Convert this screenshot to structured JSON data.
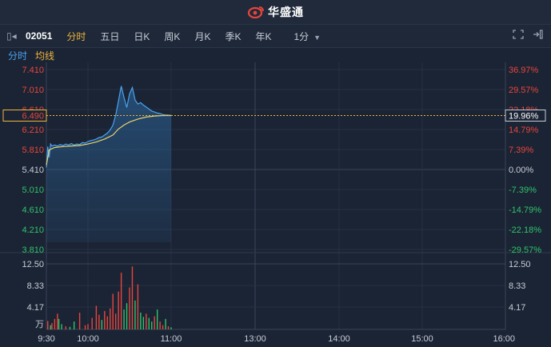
{
  "header": {
    "brand": "华盛通"
  },
  "toolbar": {
    "code": "02051",
    "tabs": [
      "分时",
      "五日",
      "日K",
      "周K",
      "月K",
      "季K",
      "年K"
    ],
    "active_tab": 0,
    "period": "1分"
  },
  "subbar": {
    "line1": "分时",
    "line2": "均线"
  },
  "colors": {
    "background": "#1b2434",
    "up": "#e8453c",
    "down": "#2fc36c",
    "neutral": "#c7cdd8",
    "price_line": "#4aa3f0",
    "avg_line": "#e8d46a",
    "accent": "#f0b43c"
  },
  "chart_data": {
    "type": "line",
    "price_axis": {
      "left_labels": [
        "7.410",
        "7.010",
        "6.610",
        "6.210",
        "5.810",
        "5.410",
        "5.010",
        "4.610",
        "4.210",
        "3.810"
      ],
      "right_labels": [
        "36.97%",
        "29.57%",
        "22.18%",
        "14.79%",
        "7.39%",
        "0.00%",
        "-7.39%",
        "-14.79%",
        "-22.18%",
        "-29.57%"
      ],
      "ylim": [
        3.61,
        7.61
      ],
      "prev_close": 5.41
    },
    "current": {
      "price": "6.490",
      "change_pct": "19.96%"
    },
    "x_labels": [
      "9:30",
      "10:00",
      "11:00",
      "13:00",
      "14:00",
      "15:00",
      "16:00"
    ],
    "price_series": [
      {
        "t": 0,
        "v": 5.45
      },
      {
        "t": 1,
        "v": 5.87
      },
      {
        "t": 2,
        "v": 5.65
      },
      {
        "t": 3,
        "v": 5.92
      },
      {
        "t": 4,
        "v": 5.88
      },
      {
        "t": 6,
        "v": 5.9
      },
      {
        "t": 8,
        "v": 5.88
      },
      {
        "t": 10,
        "v": 5.91
      },
      {
        "t": 12,
        "v": 5.89
      },
      {
        "t": 14,
        "v": 5.92
      },
      {
        "t": 16,
        "v": 5.9
      },
      {
        "t": 18,
        "v": 5.93
      },
      {
        "t": 20,
        "v": 5.9
      },
      {
        "t": 22,
        "v": 5.92
      },
      {
        "t": 24,
        "v": 5.91
      },
      {
        "t": 26,
        "v": 5.95
      },
      {
        "t": 28,
        "v": 5.94
      },
      {
        "t": 30,
        "v": 5.97
      },
      {
        "t": 32,
        "v": 5.99
      },
      {
        "t": 34,
        "v": 6.0
      },
      {
        "t": 36,
        "v": 6.02
      },
      {
        "t": 38,
        "v": 6.05
      },
      {
        "t": 40,
        "v": 6.06
      },
      {
        "t": 42,
        "v": 6.1
      },
      {
        "t": 44,
        "v": 6.14
      },
      {
        "t": 46,
        "v": 6.2
      },
      {
        "t": 48,
        "v": 6.3
      },
      {
        "t": 50,
        "v": 6.5
      },
      {
        "t": 52,
        "v": 6.78
      },
      {
        "t": 54,
        "v": 7.08
      },
      {
        "t": 56,
        "v": 6.85
      },
      {
        "t": 58,
        "v": 6.65
      },
      {
        "t": 60,
        "v": 6.92
      },
      {
        "t": 62,
        "v": 7.05
      },
      {
        "t": 64,
        "v": 6.8
      },
      {
        "t": 66,
        "v": 6.72
      },
      {
        "t": 68,
        "v": 6.75
      },
      {
        "t": 70,
        "v": 6.7
      },
      {
        "t": 72,
        "v": 6.66
      },
      {
        "t": 74,
        "v": 6.62
      },
      {
        "t": 76,
        "v": 6.58
      },
      {
        "t": 78,
        "v": 6.56
      },
      {
        "t": 80,
        "v": 6.54
      },
      {
        "t": 82,
        "v": 6.53
      },
      {
        "t": 84,
        "v": 6.51
      },
      {
        "t": 86,
        "v": 6.5
      },
      {
        "t": 88,
        "v": 6.5
      },
      {
        "t": 90,
        "v": 6.49
      }
    ],
    "avg_series": [
      {
        "t": 0,
        "v": 5.5
      },
      {
        "t": 2,
        "v": 5.8
      },
      {
        "t": 6,
        "v": 5.85
      },
      {
        "t": 12,
        "v": 5.87
      },
      {
        "t": 18,
        "v": 5.88
      },
      {
        "t": 24,
        "v": 5.89
      },
      {
        "t": 30,
        "v": 5.92
      },
      {
        "t": 36,
        "v": 5.96
      },
      {
        "t": 42,
        "v": 6.02
      },
      {
        "t": 48,
        "v": 6.1
      },
      {
        "t": 52,
        "v": 6.22
      },
      {
        "t": 56,
        "v": 6.3
      },
      {
        "t": 60,
        "v": 6.36
      },
      {
        "t": 66,
        "v": 6.42
      },
      {
        "t": 72,
        "v": 6.46
      },
      {
        "t": 78,
        "v": 6.48
      },
      {
        "t": 84,
        "v": 6.49
      },
      {
        "t": 90,
        "v": 6.49
      }
    ],
    "volume_axis": {
      "labels": [
        "12.50",
        "8.33",
        "4.17"
      ],
      "unit": "万",
      "ylim": [
        0,
        12.5
      ]
    },
    "volume_series": [
      {
        "t": 1,
        "v": 1.6,
        "dir": "up"
      },
      {
        "t": 3,
        "v": 0.8,
        "dir": "down"
      },
      {
        "t": 4,
        "v": 1.2,
        "dir": "up"
      },
      {
        "t": 6,
        "v": 2.0,
        "dir": "up"
      },
      {
        "t": 8,
        "v": 3.0,
        "dir": "up"
      },
      {
        "t": 9,
        "v": 2.0,
        "dir": "down"
      },
      {
        "t": 11,
        "v": 1.0,
        "dir": "down"
      },
      {
        "t": 14,
        "v": 0.6,
        "dir": "up"
      },
      {
        "t": 17,
        "v": 0.5,
        "dir": "down"
      },
      {
        "t": 20,
        "v": 1.5,
        "dir": "down"
      },
      {
        "t": 24,
        "v": 3.2,
        "dir": "up"
      },
      {
        "t": 28,
        "v": 0.8,
        "dir": "up"
      },
      {
        "t": 30,
        "v": 1.0,
        "dir": "up"
      },
      {
        "t": 33,
        "v": 2.2,
        "dir": "up"
      },
      {
        "t": 36,
        "v": 4.5,
        "dir": "up"
      },
      {
        "t": 38,
        "v": 2.8,
        "dir": "up"
      },
      {
        "t": 40,
        "v": 1.8,
        "dir": "down"
      },
      {
        "t": 42,
        "v": 3.5,
        "dir": "up"
      },
      {
        "t": 44,
        "v": 2.5,
        "dir": "up"
      },
      {
        "t": 46,
        "v": 4.0,
        "dir": "up"
      },
      {
        "t": 48,
        "v": 6.8,
        "dir": "up"
      },
      {
        "t": 50,
        "v": 3.0,
        "dir": "up"
      },
      {
        "t": 52,
        "v": 7.2,
        "dir": "up"
      },
      {
        "t": 54,
        "v": 10.8,
        "dir": "up"
      },
      {
        "t": 56,
        "v": 3.8,
        "dir": "down"
      },
      {
        "t": 58,
        "v": 5.0,
        "dir": "down"
      },
      {
        "t": 60,
        "v": 8.0,
        "dir": "up"
      },
      {
        "t": 62,
        "v": 12.0,
        "dir": "up"
      },
      {
        "t": 64,
        "v": 5.5,
        "dir": "down"
      },
      {
        "t": 66,
        "v": 8.6,
        "dir": "up"
      },
      {
        "t": 68,
        "v": 3.2,
        "dir": "down"
      },
      {
        "t": 70,
        "v": 2.4,
        "dir": "down"
      },
      {
        "t": 72,
        "v": 3.0,
        "dir": "up"
      },
      {
        "t": 74,
        "v": 2.2,
        "dir": "down"
      },
      {
        "t": 76,
        "v": 1.5,
        "dir": "down"
      },
      {
        "t": 78,
        "v": 2.5,
        "dir": "up"
      },
      {
        "t": 80,
        "v": 3.8,
        "dir": "down"
      },
      {
        "t": 82,
        "v": 1.5,
        "dir": "up"
      },
      {
        "t": 84,
        "v": 0.8,
        "dir": "up"
      },
      {
        "t": 86,
        "v": 2.0,
        "dir": "down"
      },
      {
        "t": 88,
        "v": 0.6,
        "dir": "up"
      },
      {
        "t": 90,
        "v": 0.4,
        "dir": "down"
      }
    ]
  }
}
